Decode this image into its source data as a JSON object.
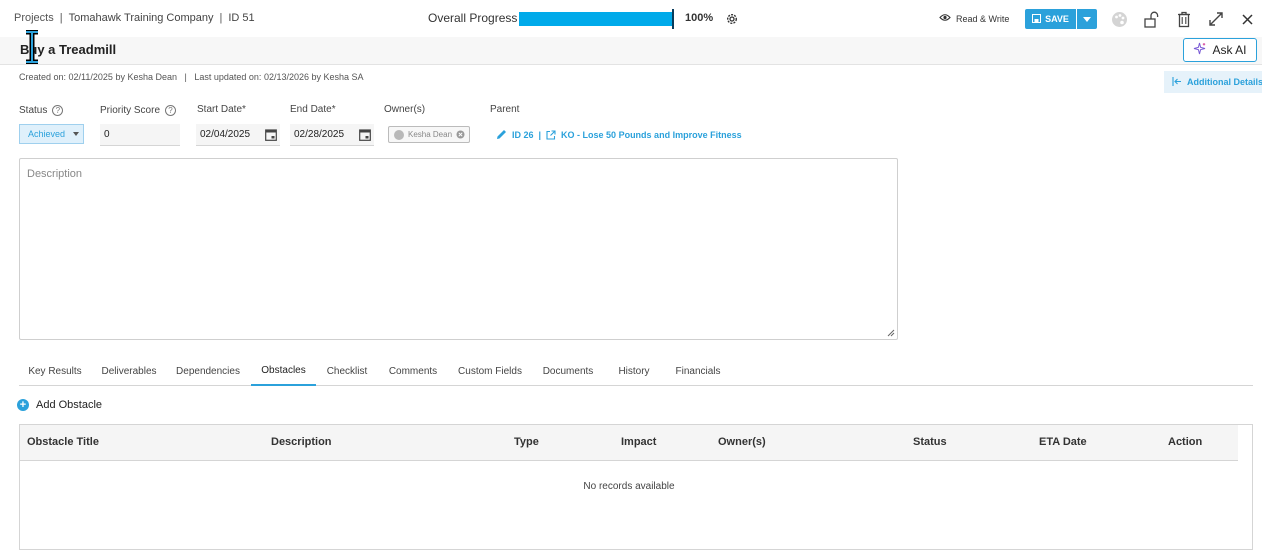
{
  "breadcrumb": {
    "projects": "Projects",
    "company": "Tomahawk Training Company",
    "id": "ID 51"
  },
  "progress": {
    "label": "Overall Progress",
    "value": 100,
    "value_text": "100%",
    "color": "#00aaea"
  },
  "toolbar": {
    "mode": "Read & Write",
    "save": "SAVE"
  },
  "title": "Buy a Treadmill",
  "ask_ai": "Ask AI",
  "meta": {
    "created_label": "Created on:",
    "created_date": "02/11/2025",
    "created_by": "by Kesha Dean",
    "updated_label": "Last updated on:",
    "updated_date": "02/13/2026",
    "updated_by": "by Kesha SA"
  },
  "additional_details": "Additional Details",
  "fields": {
    "status_label": "Status",
    "status_value": "Achieved",
    "priority_label": "Priority Score",
    "priority_value": "0",
    "start_label": "Start Date*",
    "start_value": "02/04/2025",
    "end_label": "End Date*",
    "end_value": "02/28/2025",
    "owners_label": "Owner(s)",
    "owner_name": "Kesha Dean",
    "parent_label": "Parent",
    "parent_id": "ID 26",
    "parent_name": "KO - Lose 50 Pounds and Improve Fitness"
  },
  "description_placeholder": "Description",
  "tabs": [
    "Key Results",
    "Deliverables",
    "Dependencies",
    "Obstacles",
    "Checklist",
    "Comments",
    "Custom Fields",
    "Documents",
    "History",
    "Financials"
  ],
  "active_tab": "Obstacles",
  "add_obstacle": "Add Obstacle",
  "table": {
    "columns": [
      "Obstacle Title",
      "Description",
      "Type",
      "Impact",
      "Owner(s)",
      "Status",
      "ETA Date",
      "Action"
    ],
    "empty": "No records available"
  },
  "colors": {
    "accent": "#2ba1db",
    "progress": "#00aaea"
  }
}
